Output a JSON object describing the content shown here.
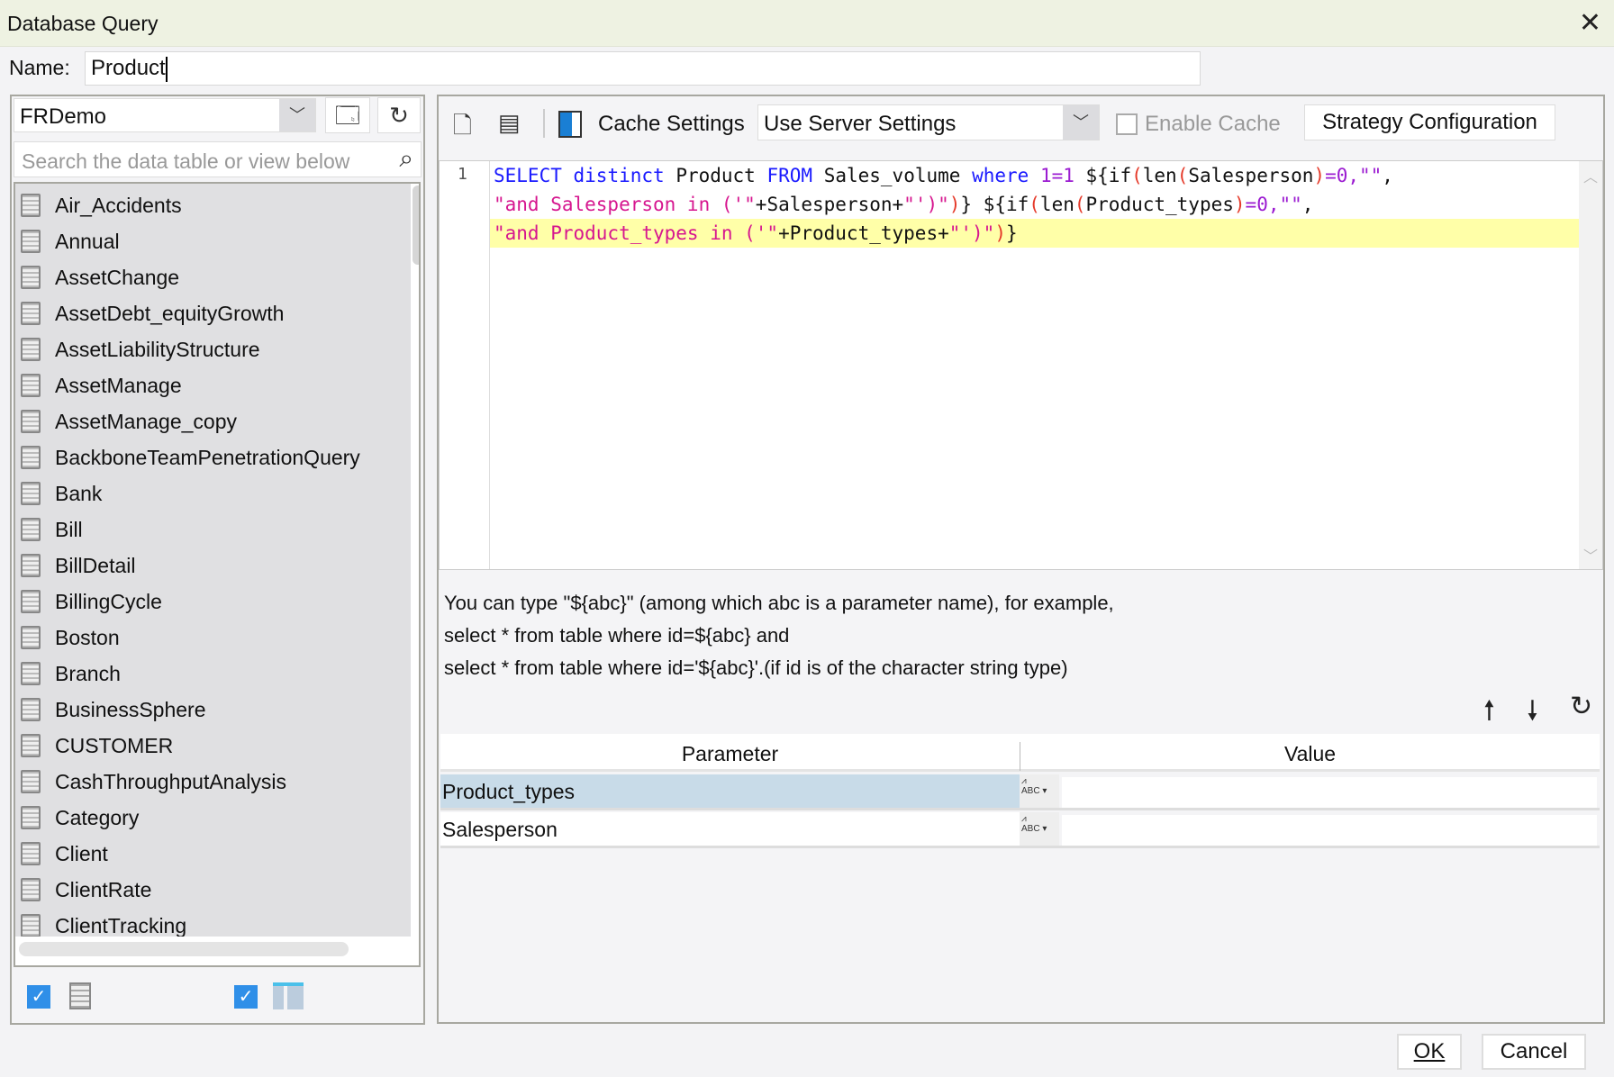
{
  "window": {
    "title": "Database Query",
    "close_icon": "close-icon"
  },
  "name_field": {
    "label": "Name:",
    "value": "Product"
  },
  "left_panel": {
    "datasource": "FRDemo",
    "search_placeholder": "Search the data table or view below",
    "tables": [
      "Air_Accidents",
      "Annual",
      "AssetChange",
      "AssetDebt_equityGrowth",
      "AssetLiabilityStructure",
      "AssetManage",
      "AssetManage_copy",
      "BackboneTeamPenetrationQuery",
      "Bank",
      "Bill",
      "BillDetail",
      "BillingCycle",
      "Boston",
      "Branch",
      "BusinessSphere",
      "CUSTOMER",
      "CashThroughputAnalysis",
      "Category",
      "Client",
      "ClientRate",
      "ClientTracking"
    ],
    "show_tables_checked": true,
    "show_views_checked": true
  },
  "toolbar": {
    "cache_settings_label": "Cache Settings",
    "cache_mode": "Use Server Settings",
    "enable_cache_label": "Enable Cache",
    "enable_cache_checked": false,
    "strategy_button": "Strategy Configuration"
  },
  "editor": {
    "line_numbers": [
      "1"
    ],
    "lines": [
      [
        {
          "t": "SELECT",
          "c": "kw"
        },
        {
          "t": " "
        },
        {
          "t": "distinct",
          "c": "kw"
        },
        {
          "t": " Product "
        },
        {
          "t": "FROM",
          "c": "kw"
        },
        {
          "t": " Sales_volume "
        },
        {
          "t": "where",
          "c": "kw"
        },
        {
          "t": " "
        },
        {
          "t": "1=1",
          "c": "num"
        },
        {
          "t": " ${if"
        },
        {
          "t": "(",
          "c": "par"
        },
        {
          "t": "len"
        },
        {
          "t": "(",
          "c": "par"
        },
        {
          "t": "Salesperson"
        },
        {
          "t": ")",
          "c": "par"
        },
        {
          "t": "=0,\"\"",
          "c": "num"
        },
        {
          "t": ","
        }
      ],
      [
        {
          "t": "\"and Salesperson in ('\"",
          "c": "str"
        },
        {
          "t": "+Salesperson+"
        },
        {
          "t": "\"')\"",
          "c": "str"
        },
        {
          "t": ")",
          "c": "par"
        },
        {
          "t": "} ${if"
        },
        {
          "t": "(",
          "c": "par"
        },
        {
          "t": "len"
        },
        {
          "t": "(",
          "c": "par"
        },
        {
          "t": "Product_types"
        },
        {
          "t": ")",
          "c": "par"
        },
        {
          "t": "=0,\"\"",
          "c": "num"
        },
        {
          "t": ","
        }
      ],
      [
        {
          "t": "\"and Product_types in ('\"",
          "c": "str"
        },
        {
          "t": "+Product_types+"
        },
        {
          "t": "\"')\"",
          "c": "str"
        },
        {
          "t": ")",
          "c": "par"
        },
        {
          "t": "}"
        }
      ]
    ],
    "highlighted_line": 2
  },
  "hint": [
    "You can type \"${abc}\" (among which abc is a parameter name), for example,",
    "select * from table where id=${abc} and",
    "select * from table where id='${abc}'.(if id is of the character string type)"
  ],
  "parameters": {
    "headers": [
      "Parameter",
      "Value"
    ],
    "rows": [
      {
        "name": "Product_types",
        "value": "",
        "selected": true
      },
      {
        "name": "Salesperson",
        "value": "",
        "selected": false
      }
    ],
    "type_icon_text": "ABC"
  },
  "footer": {
    "ok": "OK",
    "cancel": "Cancel"
  },
  "colors": {
    "title_bar": "#eef2e2",
    "selected_row": "#c8dbe8",
    "current_line": "#ffffa8",
    "keyword": "#1a1aff",
    "string": "#d6168f",
    "checkbox": "#2f8fe8"
  }
}
